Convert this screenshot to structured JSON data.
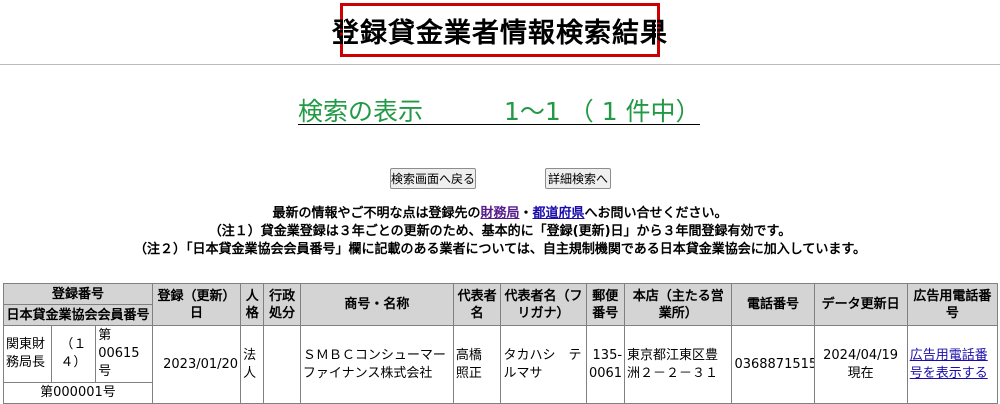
{
  "header": {
    "title": "登録貸金業者情報検索結果"
  },
  "result": {
    "label": "検索の表示",
    "count": "1～1 （ 1 件中）"
  },
  "buttons": {
    "back": "検索画面へ戻る",
    "detail": "詳細検索へ"
  },
  "notes": {
    "line1_pre": "最新の情報やご不明な点は登録先の",
    "link_zaimukyoku": "財務局",
    "sep": "・",
    "link_todofuken": "都道府県",
    "line1_post": "へお問い合せください。",
    "line2": "（注１）貸金業登録は３年ごとの更新のため、基本的に「登録(更新)日」から３年間登録有効です。",
    "line3": "（注２）「日本貸金業協会会員番号」欄に記載のある業者については、自主規制機関である日本貸金業協会に加入しています。"
  },
  "table": {
    "headers": {
      "reg_no": "登録番号",
      "assoc_no": "日本貸金業協会会員番号",
      "reg_date": "登録（更新）日",
      "personality": "人格",
      "admin_action": "行政処分",
      "name": "商号・名称",
      "representative": "代表者名",
      "rep_kana": "代表者名（フリガナ）",
      "postal": "郵便番号",
      "address": "本店（主たる営業所）",
      "phone": "電話番号",
      "updated": "データ更新日",
      "ad_phone": "広告用電話番号"
    },
    "row": {
      "authority": "関東財務局長",
      "renewals": "（１４）",
      "reg_number": "第00615号",
      "assoc_no": "第000001号",
      "reg_date": "2023/01/20",
      "personality": "法人",
      "admin_action": "",
      "name": "ＳＭＢＣコンシューマーファイナンス株式会社",
      "representative": "高橋　照正",
      "rep_kana": "タカハシ　テルマサ",
      "postal": "135-0061",
      "address": "東京都江東区豊洲２－２－３１",
      "phone": "0368871515",
      "updated_date": "2024/04/19",
      "updated_note": "現在",
      "ad_phone_link": "広告用電話番号を表示する"
    }
  }
}
